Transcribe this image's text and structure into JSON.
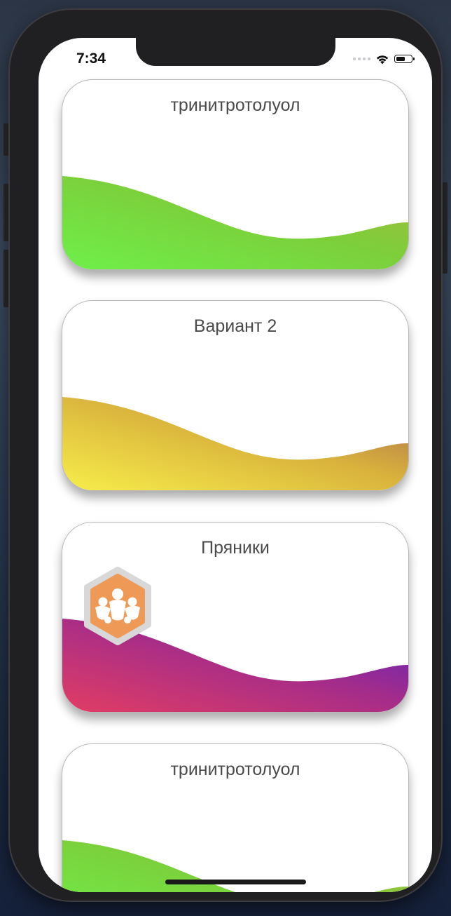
{
  "status_bar": {
    "time": "7:34"
  },
  "cards": [
    {
      "title": "тринитротолуол",
      "gradient": [
        "#6ef04a",
        "#7ccf3a",
        "#a8b83a"
      ]
    },
    {
      "title": "Вариант 2",
      "gradient": [
        "#f7ee4a",
        "#d9b23c",
        "#a86a52"
      ]
    },
    {
      "title": "Пряники",
      "gradient": [
        "#e23d63",
        "#a42c8a",
        "#5a24c0"
      ]
    },
    {
      "title": "тринитротолуол",
      "gradient": [
        "#6ef04a",
        "#7ccf3a",
        "#a8b83a"
      ]
    }
  ],
  "badge": {
    "icon": "people-cluster-icon",
    "color": "#ee9a56",
    "border_color": "#d8d8d8"
  }
}
